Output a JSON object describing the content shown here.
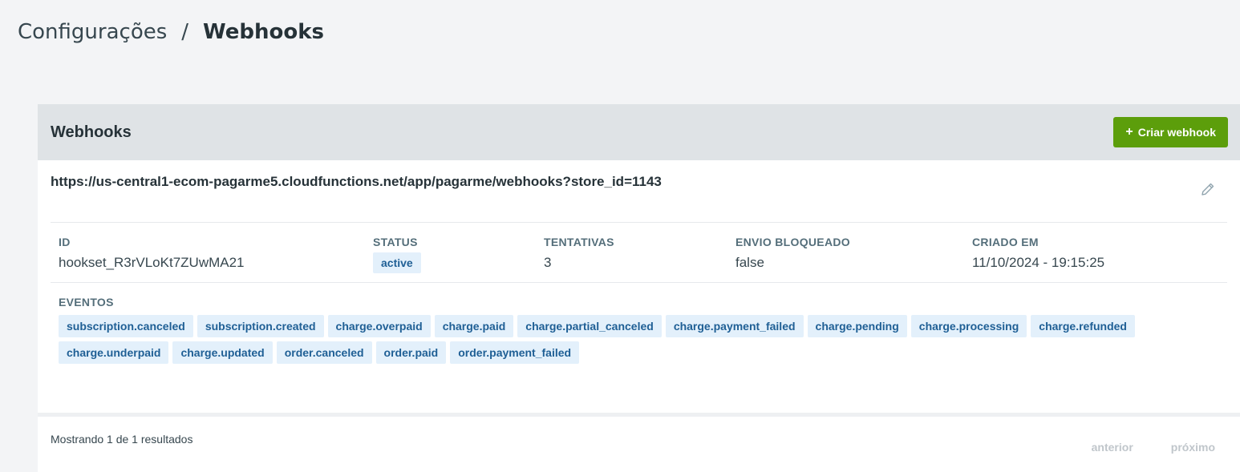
{
  "breadcrumb": {
    "parent": "Configurações",
    "separator": "/",
    "current": "Webhooks"
  },
  "card": {
    "title": "Webhooks",
    "create_button": {
      "icon": "plus-icon",
      "label": "Criar webhook"
    }
  },
  "webhook": {
    "url": "https://us-central1-ecom-pagarme5.cloudfunctions.net/app/pagarme/webhooks?store_id=1143",
    "edit_icon": "pencil-icon",
    "fields": {
      "id_label": "ID",
      "id_value": "hookset_R3rVLoKt7ZUwMA21",
      "status_label": "STATUS",
      "status_value": "active",
      "attempts_label": "TENTATIVAS",
      "attempts_value": "3",
      "blocked_label": "ENVIO BLOQUEADO",
      "blocked_value": "false",
      "created_label": "CRIADO EM",
      "created_value": "11/10/2024 - 19:15:25"
    },
    "events_label": "EVENTOS",
    "events": [
      "subscription.canceled",
      "subscription.created",
      "charge.overpaid",
      "charge.paid",
      "charge.partial_canceled",
      "charge.payment_failed",
      "charge.pending",
      "charge.processing",
      "charge.refunded",
      "charge.underpaid",
      "charge.updated",
      "order.canceled",
      "order.paid",
      "order.payment_failed"
    ]
  },
  "footer": {
    "results_text": "Mostrando 1 de 1 resultados",
    "prev_label": "anterior",
    "next_label": "próximo"
  },
  "colors": {
    "primary_button": "#5c9e0b",
    "tag_background": "#e3f0fb",
    "tag_text": "#1f5f95",
    "header_background": "#dfe3e6"
  }
}
